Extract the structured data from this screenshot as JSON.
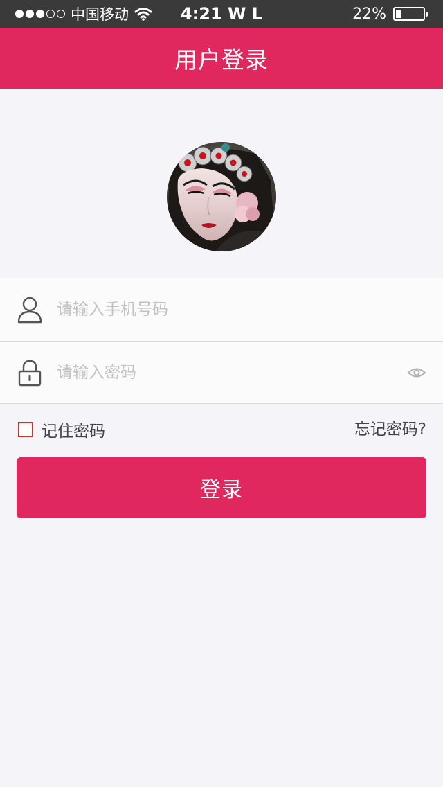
{
  "status_bar": {
    "carrier": "中国移动",
    "time": "4:21 W L",
    "battery_text": "22%",
    "battery_level": 0.22,
    "signal_bars_filled": 3,
    "signal_bars_total": 5
  },
  "header": {
    "title": "用户登录"
  },
  "login_form": {
    "phone_placeholder": "请输入手机号码",
    "password_placeholder": "请输入密码",
    "remember_label": "记住密码",
    "remember_checked": false,
    "forgot_label": "忘记密码?",
    "submit_label": "登录"
  },
  "colors": {
    "brand": "#e0285e",
    "status_bar_bg": "#3a3a3a",
    "page_bg": "#f5f4f9",
    "checkbox_border": "#c9332e"
  }
}
